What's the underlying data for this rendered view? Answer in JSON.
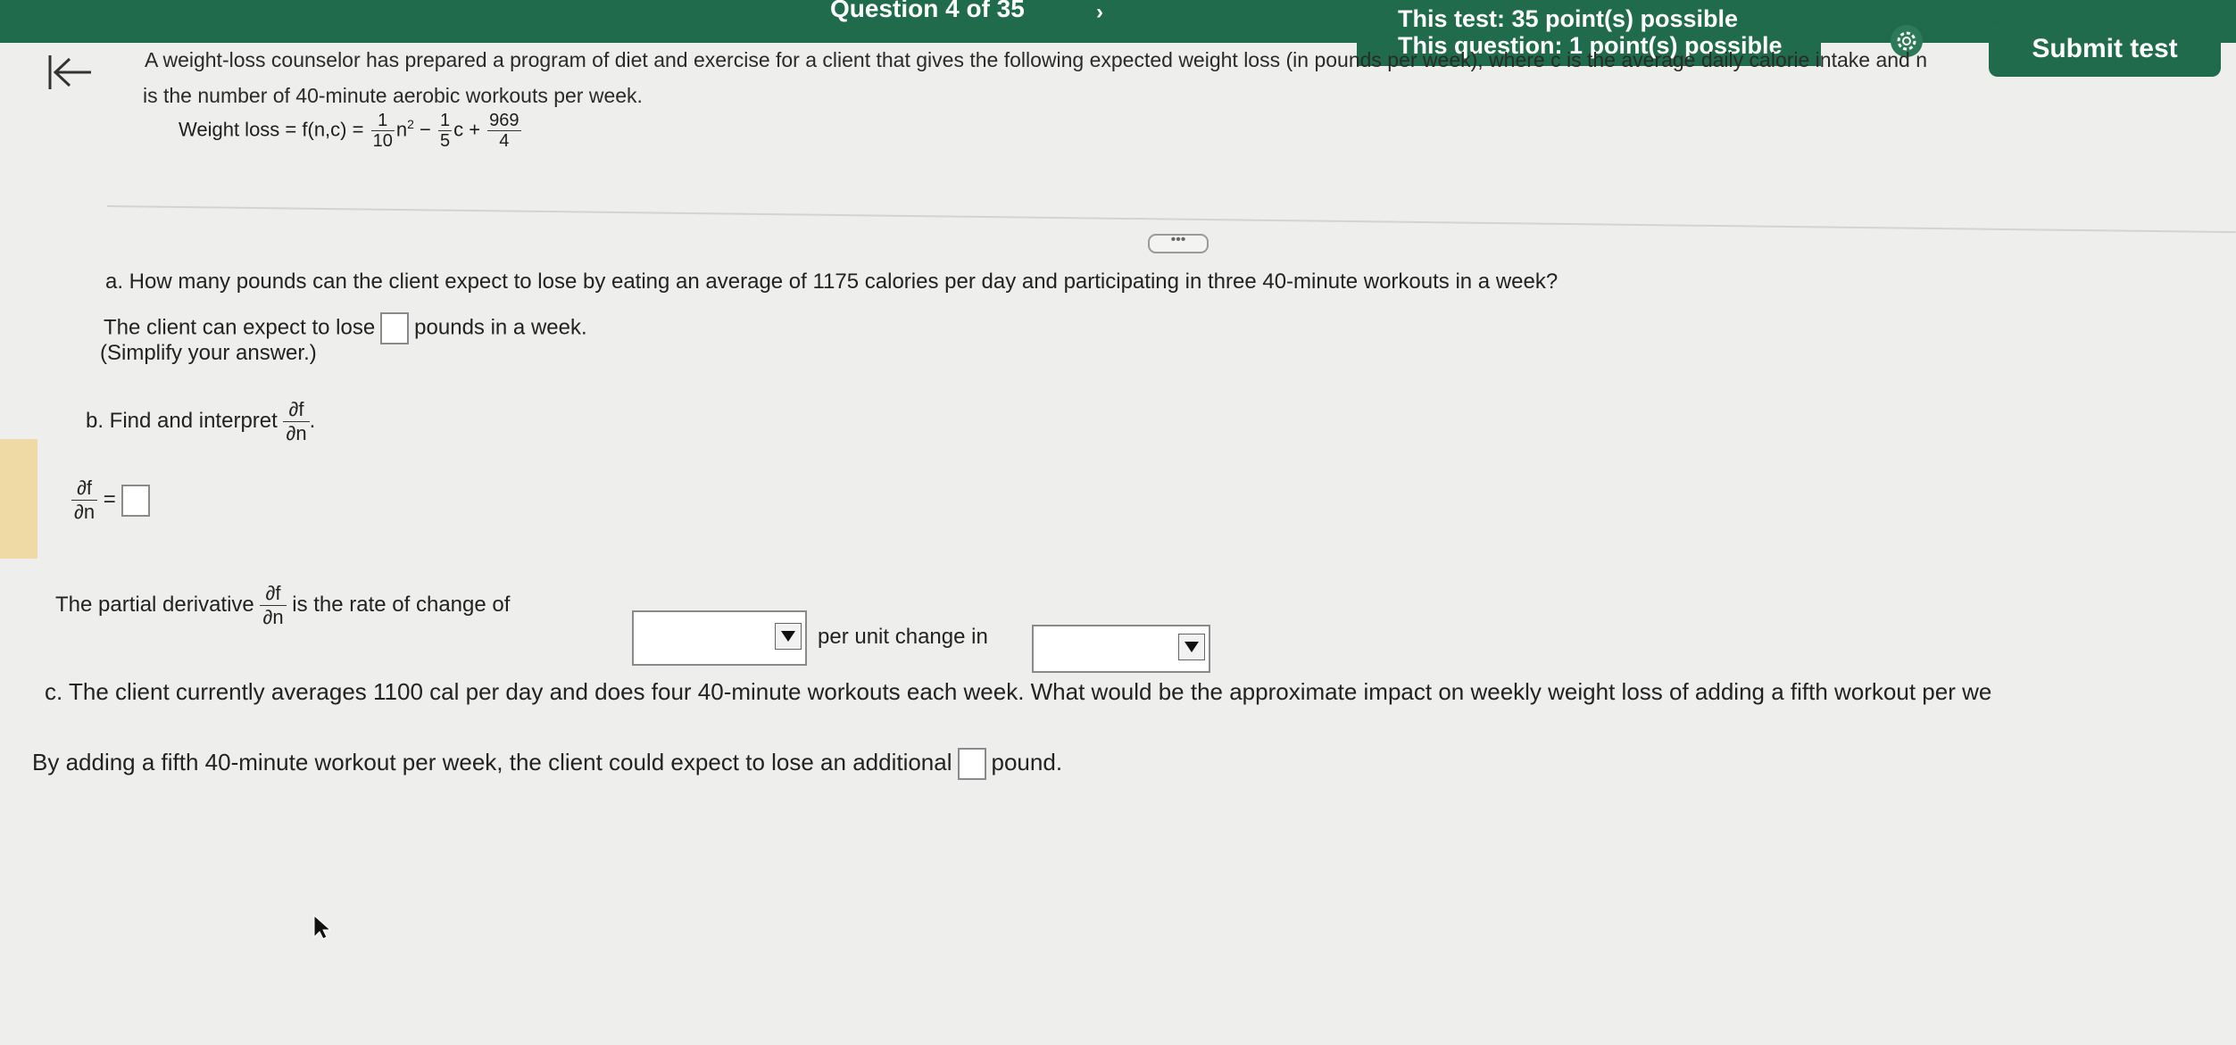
{
  "header": {
    "question_counter": "Question 4 of 35",
    "next_symbol": "›",
    "test_points": "This test: 35 point(s) possible",
    "question_points": "This question: 1 point(s) possible",
    "submit_label": "Submit test"
  },
  "problem": {
    "line1": "A weight-loss counselor has prepared a program of diet and exercise for a client that gives the following expected weight loss (in pounds per week), where c is the average daily calorie intake and n",
    "line2": "is the number of 40-minute aerobic workouts per week.",
    "formula_lhs": "Weight loss = f(n,c) =",
    "f1_num": "1",
    "f1_den": "10",
    "term1_var": "n",
    "minus": " − ",
    "f2_num": "1",
    "f2_den": "5",
    "term2_var": "c +",
    "f3_num": "969",
    "f3_den": "4"
  },
  "more_label": "•••",
  "part_a": {
    "question": "a. How many pounds can the client expect to lose by eating an average of 1175 calories per day and participating in three 40-minute workouts in a week?",
    "answer_prefix": "The client can expect to lose",
    "answer_suffix": "pounds in a week.",
    "hint": "(Simplify your answer.)"
  },
  "part_b": {
    "question_prefix": "b. Find and interpret",
    "question_suffix": ".",
    "pd_num": "∂f",
    "pd_den": "∂n",
    "equals": "=",
    "interp_prefix": "The partial derivative",
    "interp_middle": "is the rate of change of",
    "interp_middle2": "per unit change in"
  },
  "part_c": {
    "question": "c. The client currently averages 1100 cal per day and does four 40-minute workouts each week. What would be the approximate impact on weekly weight loss of adding a fifth workout per we",
    "answer_prefix": "By adding a fifth 40-minute workout per week, the client could expect to lose an additional",
    "answer_suffix": "pound."
  }
}
